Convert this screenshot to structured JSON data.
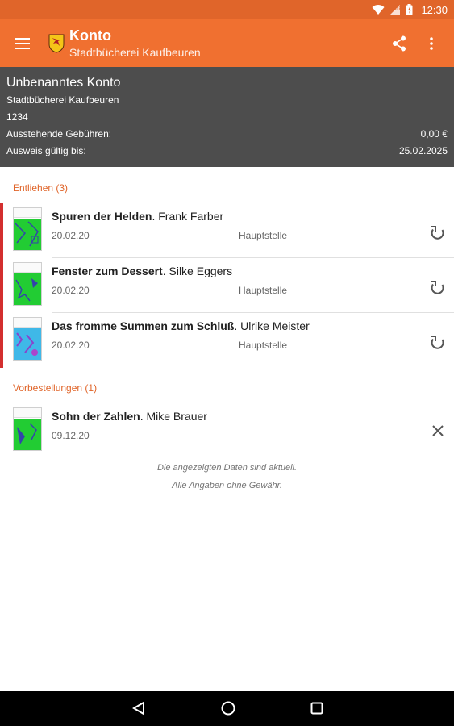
{
  "status_bar": {
    "time": "12:30",
    "icons": [
      "wifi-icon",
      "signal-icon",
      "battery-icon"
    ],
    "background": "#e0652a"
  },
  "toolbar": {
    "title": "Konto",
    "subtitle": "Stadtbücherei Kaufbeuren",
    "icons": [
      "menu-icon",
      "library-logo",
      "share-icon",
      "overflow-menu-icon"
    ],
    "background": "#f07030"
  },
  "account": {
    "name": "Unbenanntes Konto",
    "library": "Stadtbücherei Kaufbeuren",
    "number": "1234",
    "fees_label": "Ausstehende Gebühren:",
    "fees_value": "0,00 €",
    "valid_label": "Ausweis gültig bis:",
    "valid_value": "25.02.2025",
    "background": "#4d4d4d"
  },
  "lent": {
    "header": "Entliehen (3)",
    "items": [
      {
        "title": "Spuren der Helden",
        "author": ". Frank Farber",
        "date": "20.02.20",
        "branch": "Hauptstelle",
        "action_icon": "renew-icon"
      },
      {
        "title": "Fenster zum Dessert",
        "author": ". Silke Eggers",
        "date": "20.02.20",
        "branch": "Hauptstelle",
        "action_icon": "renew-icon"
      },
      {
        "title": "Das fromme Summen zum Schluß",
        "author": ". Ulrike Meister",
        "date": "20.02.20",
        "branch": "Hauptstelle",
        "action_icon": "renew-icon"
      }
    ]
  },
  "reservations": {
    "header": "Vorbestellungen (1)",
    "items": [
      {
        "title": "Sohn der Zahlen",
        "author": ". Mike Brauer",
        "date": "09.12.20",
        "action_icon": "close-icon"
      }
    ]
  },
  "footer": {
    "line1": "Die angezeigten Daten sind aktuell.",
    "line2": "Alle Angaben ohne Gewähr."
  },
  "nav_bar": {
    "icons": [
      "back-icon",
      "home-icon",
      "recents-icon"
    ]
  },
  "colors": {
    "accent": "#e0652a",
    "overdue_bar": "#d32f2f"
  }
}
